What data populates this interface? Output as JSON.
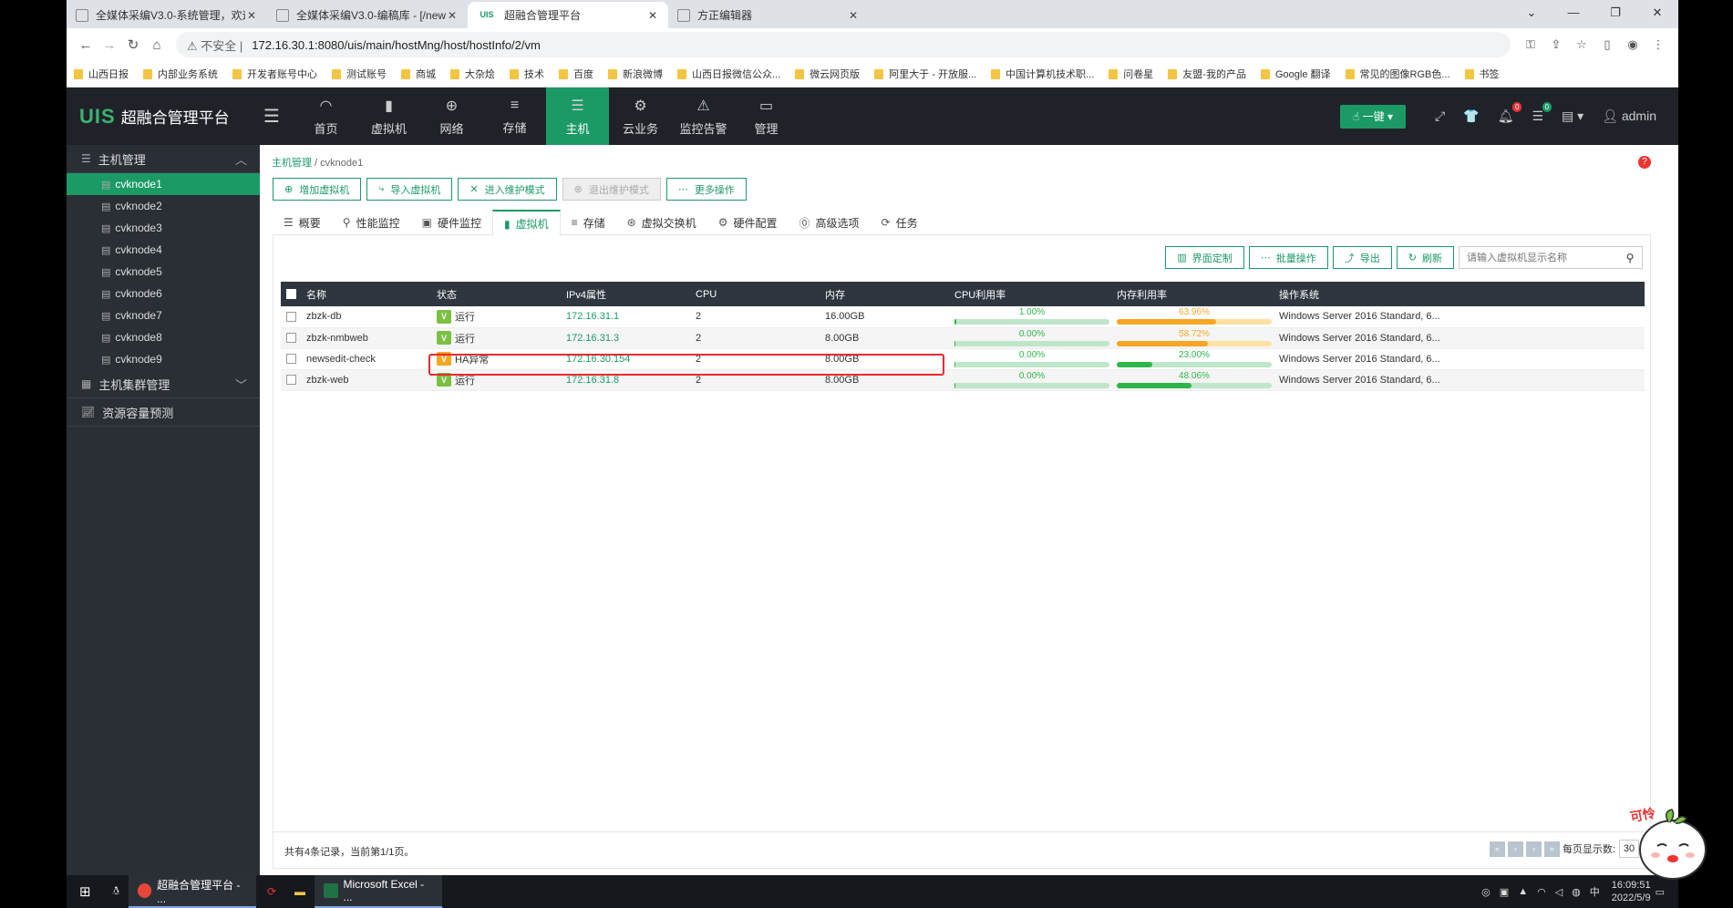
{
  "browser": {
    "tabs": [
      {
        "title": "全媒体采编V3.0-系统管理，欢迎..."
      },
      {
        "title": "全媒体采编V3.0-编稿库 - [/new..."
      },
      {
        "title": "超融合管理平台",
        "favicon": "UIS"
      },
      {
        "title": "方正编辑器"
      }
    ],
    "not_secure": "不安全",
    "url": "172.16.30.1:8080/uis/main/hostMng/host/hostInfo/2/vm",
    "bookmarks": [
      "山西日报",
      "内部业务系统",
      "开发者账号中心",
      "测试账号",
      "商城",
      "大杂烩",
      "技术",
      "百度",
      "新浪微博",
      "山西日报微信公众...",
      "微云网页版",
      "阿里大于 - 开放服...",
      "中国计算机技术职...",
      "问卷星",
      "友盟-我的产品",
      "Google 翻译",
      "常见的图像RGB色...",
      "书签"
    ]
  },
  "header": {
    "logo_mark": "UIS",
    "logo_text": "超融合管理平台",
    "nav": [
      {
        "label": "首页",
        "icon": "dashboard-icon"
      },
      {
        "label": "虚拟机",
        "icon": "vm-icon"
      },
      {
        "label": "网络",
        "icon": "globe-icon"
      },
      {
        "label": "存储",
        "icon": "database-icon"
      },
      {
        "label": "主机",
        "icon": "server-icon",
        "active": true
      },
      {
        "label": "云业务",
        "icon": "gear-icon"
      },
      {
        "label": "监控告警",
        "icon": "bell-icon"
      },
      {
        "label": "管理",
        "icon": "monitor-icon"
      }
    ],
    "onekey_label": "一键",
    "alarm_count": "0",
    "task_count": "0",
    "user": "admin"
  },
  "sidebar": {
    "group1": "主机管理",
    "nodes": [
      "cvknode1",
      "cvknode2",
      "cvknode3",
      "cvknode4",
      "cvknode5",
      "cvknode6",
      "cvknode7",
      "cvknode8",
      "cvknode9"
    ],
    "group2": "主机集群管理",
    "group3": "资源容量预测"
  },
  "main": {
    "breadcrumb": {
      "root": "主机管理",
      "current": "cvknode1"
    },
    "actions": [
      "增加虚拟机",
      "导入虚拟机",
      "进入维护模式",
      "退出维护模式",
      "更多操作"
    ],
    "subtabs": [
      "概要",
      "性能监控",
      "硬件监控",
      "虚拟机",
      "存储",
      "虚拟交换机",
      "硬件配置",
      "高级选项",
      "任务"
    ],
    "tools": [
      "界面定制",
      "批量操作",
      "导出",
      "刷新"
    ],
    "search_placeholder": "请输入虚拟机显示名称",
    "columns": [
      "名称",
      "状态",
      "IPv4属性",
      "CPU",
      "内存",
      "CPU利用率",
      "内存利用率",
      "操作系统"
    ],
    "rows": [
      {
        "name": "zbzk-db",
        "status": "运行",
        "ip": "172.16.31.1",
        "cpu": "2",
        "mem": "16.00GB",
        "cpu_util": "1.00%",
        "cpu_pct": 1.0,
        "mem_util": "63.96%",
        "mem_pct": 63.96,
        "mem_color": "orange",
        "os": "Windows Server 2016 Standard, 6..."
      },
      {
        "name": "zbzk-nmbweb",
        "status": "运行",
        "ip": "172.16.31.3",
        "cpu": "2",
        "mem": "8.00GB",
        "cpu_util": "0.00%",
        "cpu_pct": 0,
        "mem_util": "58.72%",
        "mem_pct": 58.72,
        "mem_color": "orange",
        "os": "Windows Server 2016 Standard, 6..."
      },
      {
        "name": "newsedit-check",
        "status": "HA异常",
        "ip": "172.16.30.154",
        "cpu": "2",
        "mem": "8.00GB",
        "cpu_util": "0.00%",
        "cpu_pct": 0,
        "mem_util": "23.00%",
        "mem_pct": 23.0,
        "mem_color": "green",
        "os": "Windows Server 2016 Standard, 6..."
      },
      {
        "name": "zbzk-web",
        "status": "运行",
        "ip": "172.16.31.8",
        "cpu": "2",
        "mem": "8.00GB",
        "cpu_util": "0.00%",
        "cpu_pct": 0,
        "mem_util": "48.06%",
        "mem_pct": 48.06,
        "mem_color": "green",
        "os": "Windows Server 2016 Standard, 6..."
      }
    ],
    "footer_text": "共有4条记录，当前第1/1页。",
    "page_size_label": "每页显示数:",
    "page_size": "30"
  },
  "taskbar": {
    "apps": [
      "超融合管理平台 - ...",
      "Microsoft Excel - ..."
    ],
    "tray_lang": "中",
    "time": "16:09:51",
    "date": "2022/5/9"
  },
  "sticker": {
    "text": "可怜"
  },
  "colors": {
    "accent": "#1b9a66",
    "header_bg": "#1f2329",
    "sidebar_bg": "#2a2f35",
    "highlight": "#e62c2c"
  }
}
